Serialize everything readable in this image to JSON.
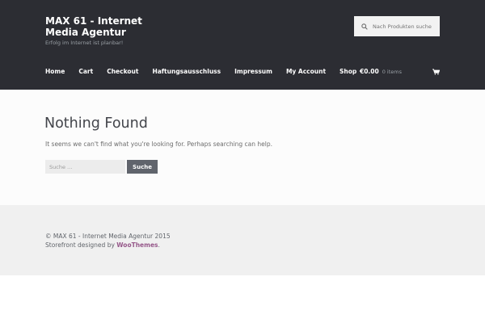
{
  "header": {
    "site_title": "MAX 61 - Internet Media Agentur",
    "tagline": "Erfolg im Internet ist planbar!",
    "search": {
      "placeholder": "Nach Produkten suche"
    },
    "icons": {
      "search": "search-icon",
      "cart": "shopping-cart-icon"
    }
  },
  "nav": {
    "items": [
      {
        "label": "Home"
      },
      {
        "label": "Cart"
      },
      {
        "label": "Checkout"
      },
      {
        "label": "Haftungsausschluss"
      },
      {
        "label": "Impressum"
      },
      {
        "label": "My Account"
      },
      {
        "label": "Shop"
      }
    ]
  },
  "cart": {
    "total": "€0.00",
    "count": "0 items"
  },
  "main": {
    "title": "Nothing Found",
    "message": "It seems we can't find what you're looking for. Perhaps searching can help.",
    "search_placeholder": "Suche …",
    "search_button": "Suche"
  },
  "footer": {
    "copyright": "© MAX 61 - Internet Media Agentur 2015",
    "credit_prefix": "Storefront designed by ",
    "credit_link": "WooThemes",
    "credit_suffix": "."
  },
  "colors": {
    "header_bg": "#2c2d33",
    "link": "#96588a",
    "button": "#60646c"
  }
}
